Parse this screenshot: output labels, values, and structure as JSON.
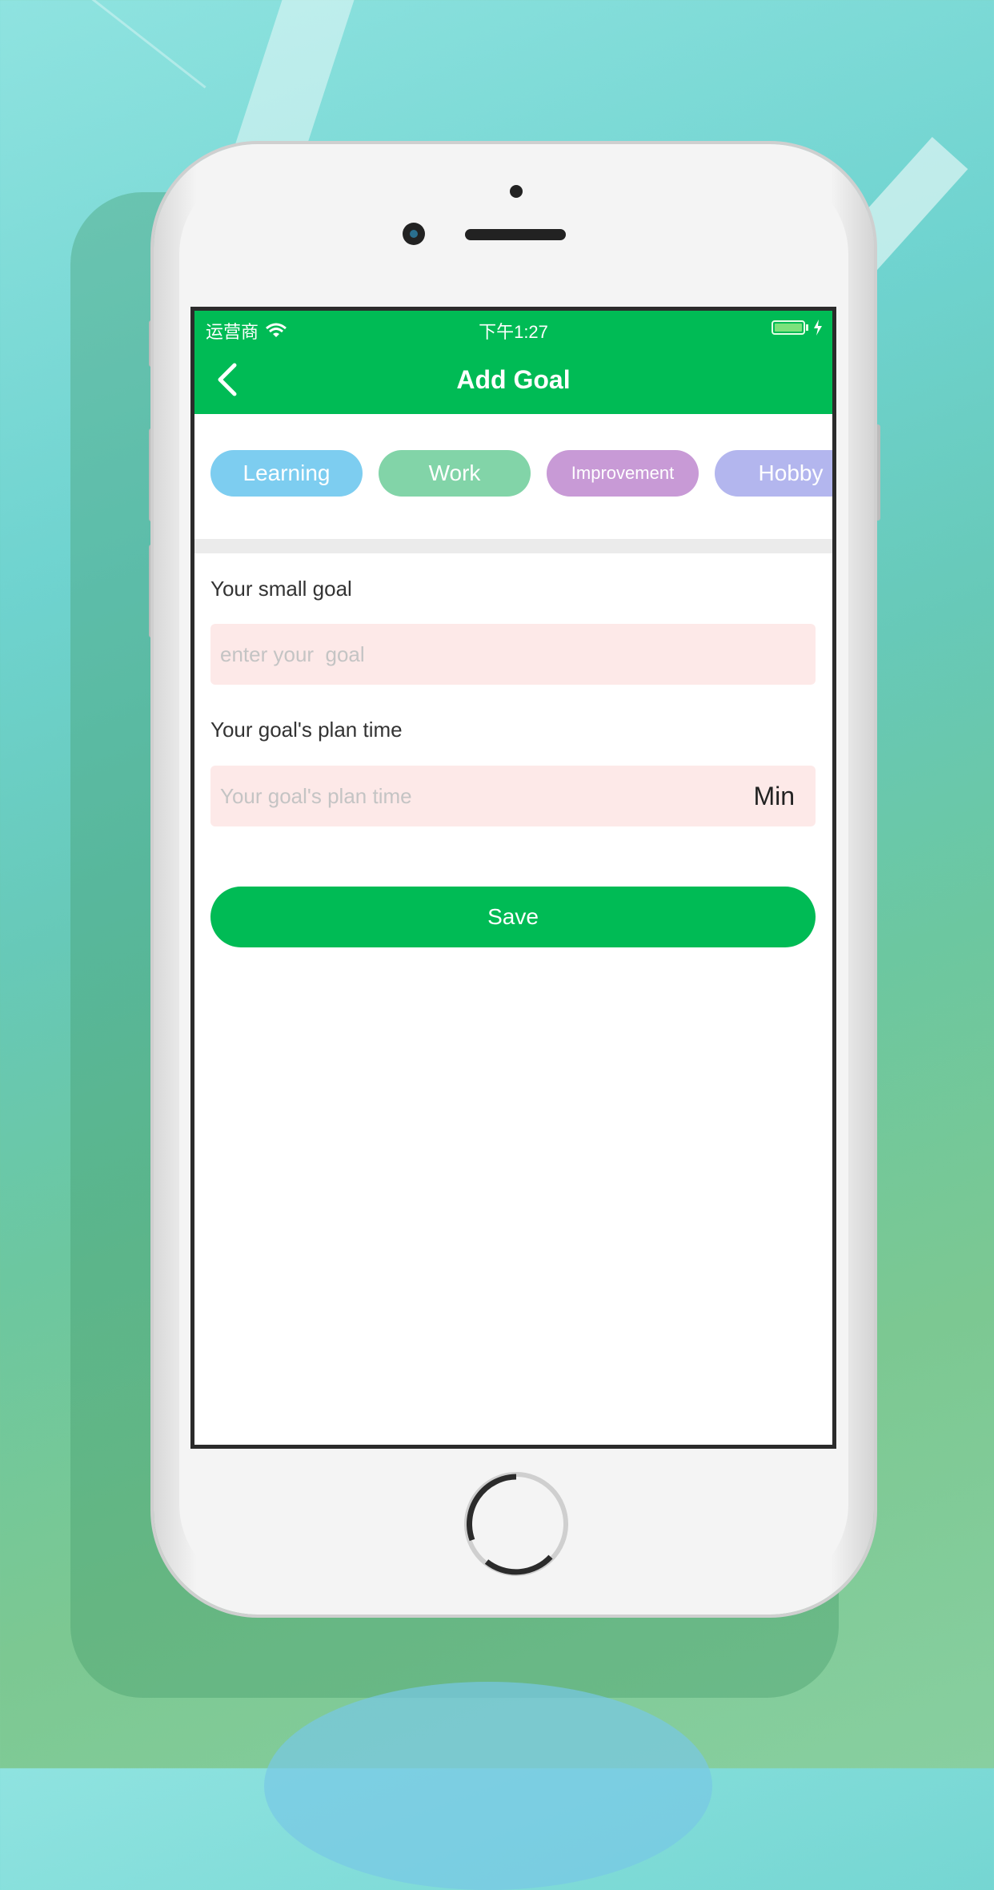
{
  "colors": {
    "accent": "#00bb55",
    "field_bg": "#fde9e8",
    "chip_learning": "#7dcdf0",
    "chip_work": "#82d4a8",
    "chip_improvement": "#c89ad6",
    "chip_hobby": "#b3b6ee"
  },
  "status_bar": {
    "carrier": "运营商",
    "time": "下午1:27",
    "wifi_icon": "wifi-icon",
    "battery_icon": "battery-icon"
  },
  "nav": {
    "back_icon": "chevron-left-icon",
    "title": "Add Goal"
  },
  "categories": [
    {
      "label": "Learning"
    },
    {
      "label": "Work"
    },
    {
      "label": "Improvement"
    },
    {
      "label": "Hobby"
    }
  ],
  "form": {
    "goal_label": "Your small goal",
    "goal_placeholder": "enter your  goal",
    "goal_value": "",
    "time_label": "Your goal's plan time",
    "time_placeholder": "Your goal's plan time",
    "time_value": "",
    "time_unit": "Min"
  },
  "actions": {
    "save_label": "Save"
  }
}
